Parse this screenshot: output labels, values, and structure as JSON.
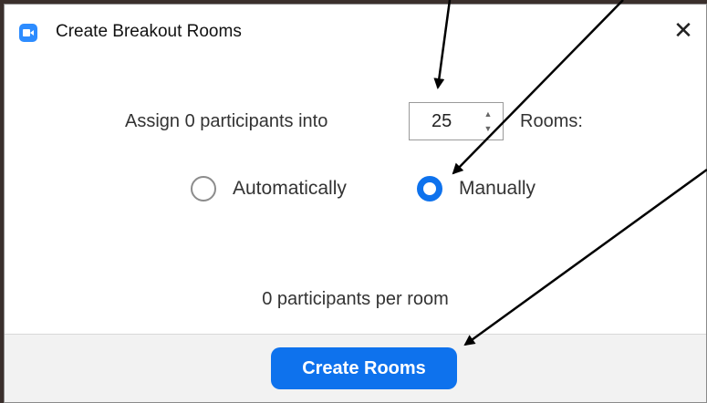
{
  "window": {
    "title": "Create Breakout Rooms",
    "close_glyph": "✕"
  },
  "assign": {
    "prefix": "Assign 0 participants into",
    "room_count": "25",
    "suffix": "Rooms:"
  },
  "mode": {
    "options": [
      {
        "label": "Automatically",
        "selected": false
      },
      {
        "label": "Manually",
        "selected": true
      }
    ]
  },
  "per_room_text": "0 participants per room",
  "footer": {
    "create_label": "Create Rooms"
  },
  "colors": {
    "accent": "#0e72ed",
    "annotation_arrow": "#000000"
  },
  "icons": {
    "app": "zoom-app-icon",
    "close": "close-icon",
    "stepper_up": "chevron-up-icon",
    "stepper_down": "chevron-down-icon"
  }
}
